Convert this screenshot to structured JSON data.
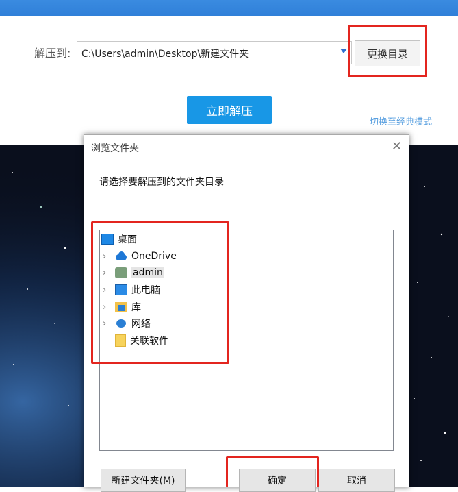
{
  "toolbar": {
    "extract_to_label": "解压到:",
    "path_value": "C:\\Users\\admin\\Desktop\\新建文件夹",
    "change_dir_label": "更换目录",
    "extract_now_label": "立即解压",
    "classic_mode_label": "切换至经典模式"
  },
  "dialog": {
    "title": "浏览文件夹",
    "close_glyph": "✕",
    "prompt": "请选择要解压到的文件夹目录",
    "tree": [
      {
        "label": "桌面",
        "icon": "desktop-icon",
        "expandable": false
      },
      {
        "label": "OneDrive",
        "icon": "cloud-icon",
        "expandable": true
      },
      {
        "label": "admin",
        "icon": "user-icon",
        "expandable": true,
        "selected": true
      },
      {
        "label": "此电脑",
        "icon": "computer-icon",
        "expandable": true
      },
      {
        "label": "库",
        "icon": "library-icon",
        "expandable": true
      },
      {
        "label": "网络",
        "icon": "network-icon",
        "expandable": true
      },
      {
        "label": "关联软件",
        "icon": "folder-icon",
        "expandable": false
      }
    ],
    "new_folder_label": "新建文件夹(M)",
    "ok_label": "确定",
    "cancel_label": "取消"
  },
  "colors": {
    "highlight": "#e3251f",
    "primary": "#1897e6",
    "link": "#5aa0e0"
  }
}
